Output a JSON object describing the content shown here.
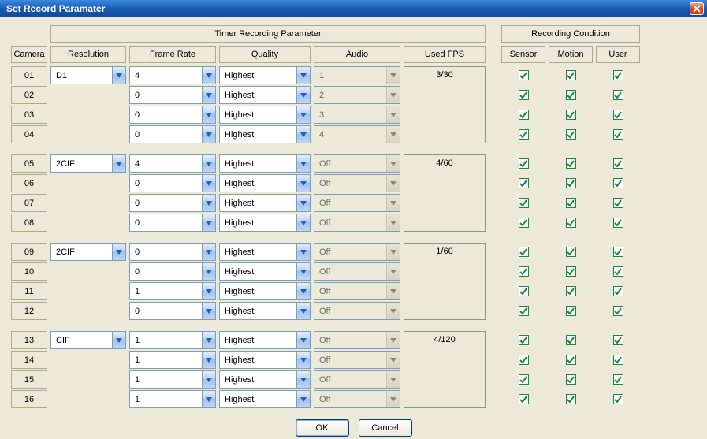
{
  "window": {
    "title": "Set Record Paramater"
  },
  "headers": {
    "timer_group": "Timer Recording Parameter",
    "cond_group": "Recording Condition",
    "camera": "Camera",
    "resolution": "Resolution",
    "frame_rate": "Frame Rate",
    "quality": "Quality",
    "audio": "Audio",
    "used_fps": "Used FPS",
    "sensor": "Sensor",
    "motion": "Motion",
    "user": "User"
  },
  "groups": [
    {
      "resolution": "D1",
      "used_fps": "3/30",
      "rows": [
        {
          "cam": "01",
          "fr": "4",
          "q": "Highest",
          "audio": "1",
          "audio_disabled": true,
          "sensor": true,
          "motion": true,
          "user": true
        },
        {
          "cam": "02",
          "fr": "0",
          "q": "Highest",
          "audio": "2",
          "audio_disabled": true,
          "sensor": true,
          "motion": true,
          "user": true
        },
        {
          "cam": "03",
          "fr": "0",
          "q": "Highest",
          "audio": "3",
          "audio_disabled": true,
          "sensor": true,
          "motion": true,
          "user": true
        },
        {
          "cam": "04",
          "fr": "0",
          "q": "Highest",
          "audio": "4",
          "audio_disabled": true,
          "sensor": true,
          "motion": true,
          "user": true
        }
      ]
    },
    {
      "resolution": "2CIF",
      "used_fps": "4/60",
      "rows": [
        {
          "cam": "05",
          "fr": "4",
          "q": "Highest",
          "audio": "Off",
          "audio_disabled": true,
          "sensor": true,
          "motion": true,
          "user": true
        },
        {
          "cam": "06",
          "fr": "0",
          "q": "Highest",
          "audio": "Off",
          "audio_disabled": true,
          "sensor": true,
          "motion": true,
          "user": true
        },
        {
          "cam": "07",
          "fr": "0",
          "q": "Highest",
          "audio": "Off",
          "audio_disabled": true,
          "sensor": true,
          "motion": true,
          "user": true
        },
        {
          "cam": "08",
          "fr": "0",
          "q": "Highest",
          "audio": "Off",
          "audio_disabled": true,
          "sensor": true,
          "motion": true,
          "user": true
        }
      ]
    },
    {
      "resolution": "2CIF",
      "used_fps": "1/60",
      "rows": [
        {
          "cam": "09",
          "fr": "0",
          "q": "Highest",
          "audio": "Off",
          "audio_disabled": true,
          "sensor": true,
          "motion": true,
          "user": true
        },
        {
          "cam": "10",
          "fr": "0",
          "q": "Highest",
          "audio": "Off",
          "audio_disabled": true,
          "sensor": true,
          "motion": true,
          "user": true
        },
        {
          "cam": "11",
          "fr": "1",
          "q": "Highest",
          "audio": "Off",
          "audio_disabled": true,
          "sensor": true,
          "motion": true,
          "user": true
        },
        {
          "cam": "12",
          "fr": "0",
          "q": "Highest",
          "audio": "Off",
          "audio_disabled": true,
          "sensor": true,
          "motion": true,
          "user": true
        }
      ]
    },
    {
      "resolution": "CIF",
      "used_fps": "4/120",
      "rows": [
        {
          "cam": "13",
          "fr": "1",
          "q": "Highest",
          "audio": "Off",
          "audio_disabled": true,
          "sensor": true,
          "motion": true,
          "user": true
        },
        {
          "cam": "14",
          "fr": "1",
          "q": "Highest",
          "audio": "Off",
          "audio_disabled": true,
          "sensor": true,
          "motion": true,
          "user": true
        },
        {
          "cam": "15",
          "fr": "1",
          "q": "Highest",
          "audio": "Off",
          "audio_disabled": true,
          "sensor": true,
          "motion": true,
          "user": true
        },
        {
          "cam": "16",
          "fr": "1",
          "q": "Highest",
          "audio": "Off",
          "audio_disabled": true,
          "sensor": true,
          "motion": true,
          "user": true
        }
      ]
    }
  ],
  "buttons": {
    "ok": "OK",
    "cancel": "Cancel"
  }
}
